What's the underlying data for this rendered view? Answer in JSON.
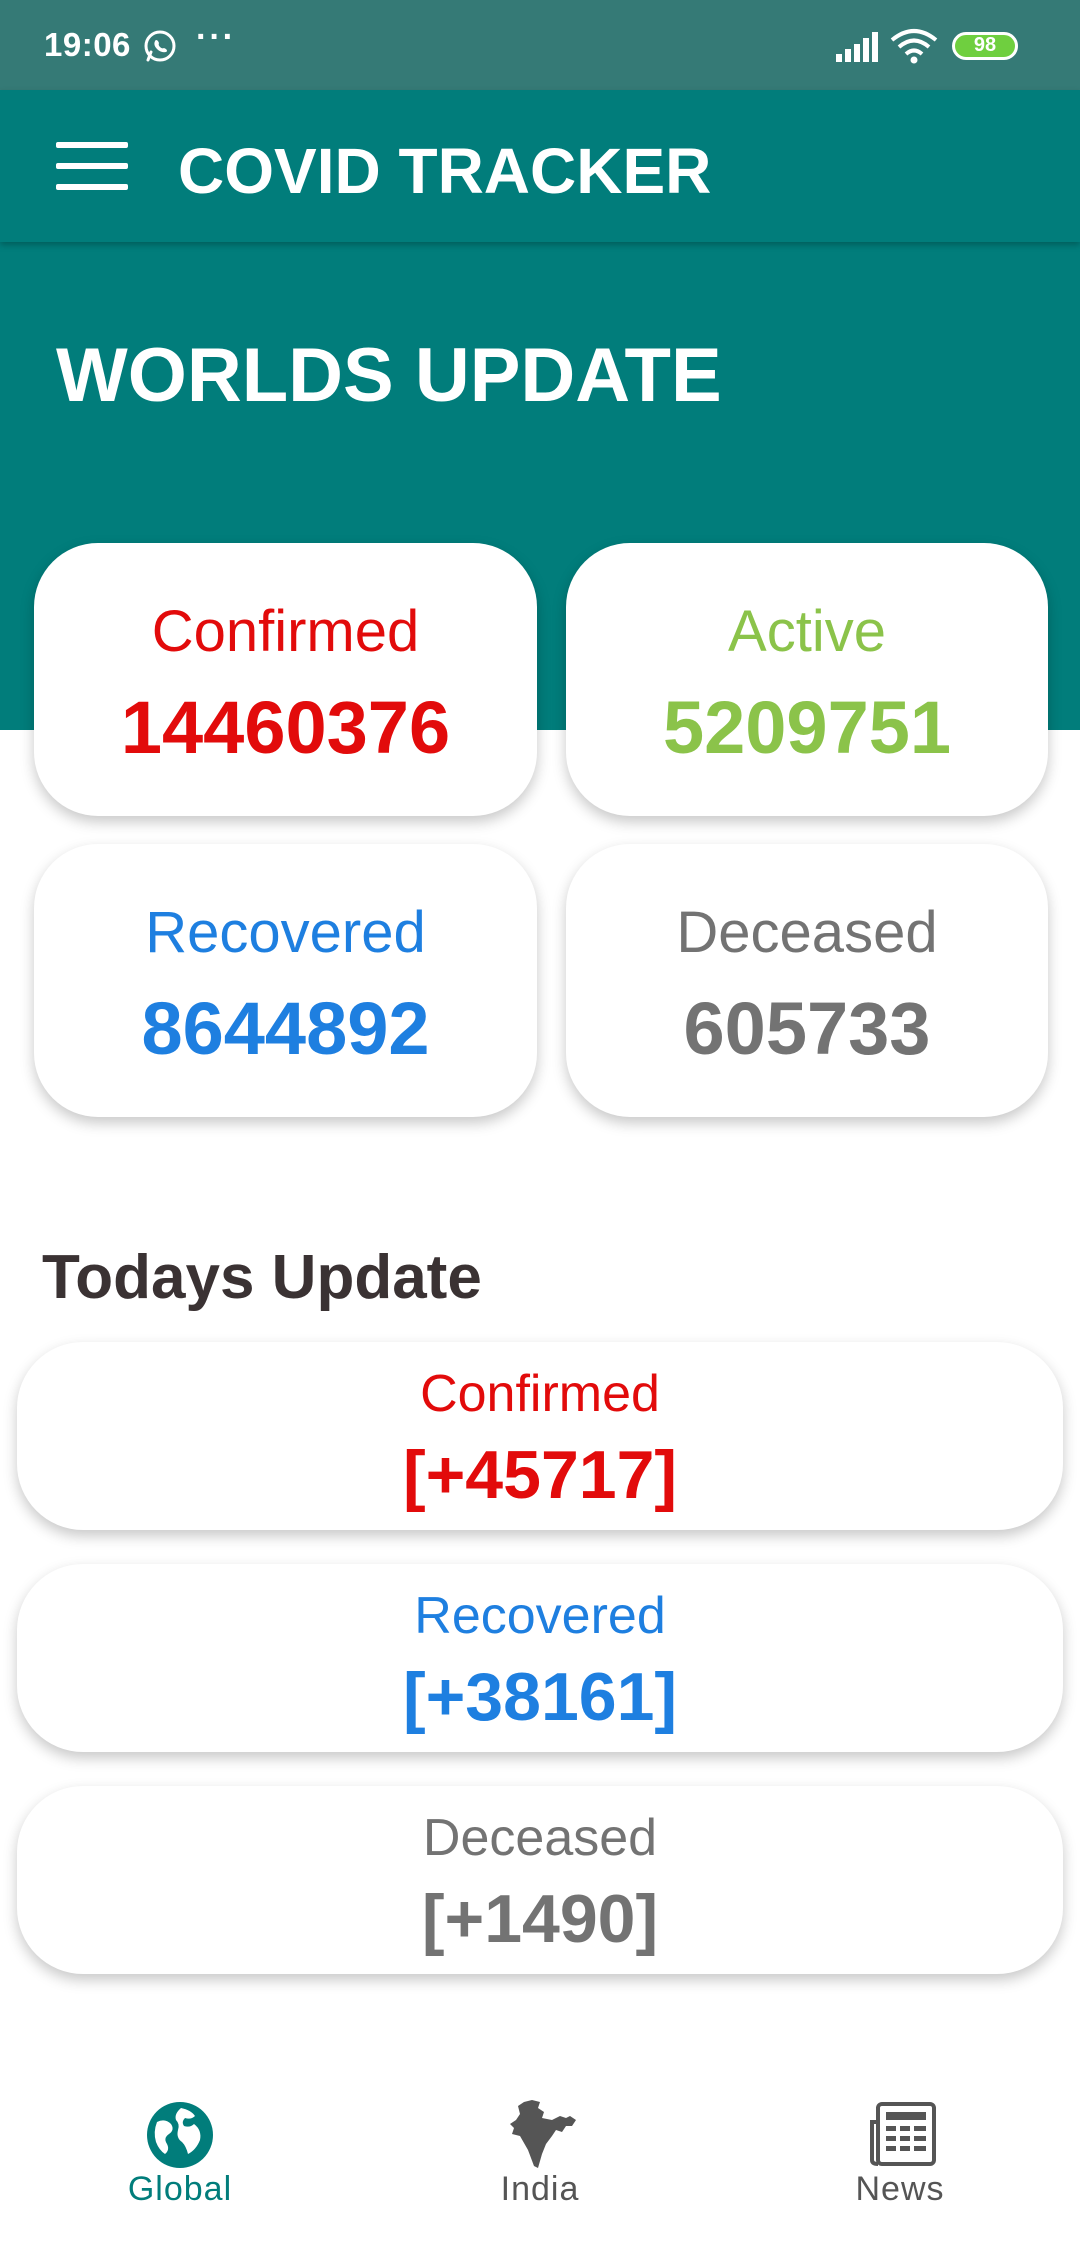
{
  "status": {
    "time": "19:06",
    "battery": "98"
  },
  "app": {
    "title": "COVID TRACKER"
  },
  "world": {
    "title": "WORLDS UPDATE",
    "confirmed_label": "Confirmed",
    "confirmed_value": "14460376",
    "active_label": "Active",
    "active_value": "5209751",
    "recovered_label": "Recovered",
    "recovered_value": "8644892",
    "deceased_label": "Deceased",
    "deceased_value": "605733"
  },
  "today": {
    "title": "Todays Update",
    "confirmed_label": "Confirmed",
    "confirmed_value": "[+45717]",
    "recovered_label": "Recovered",
    "recovered_value": "[+38161]",
    "deceased_label": "Deceased",
    "deceased_value": "[+1490]"
  },
  "nav": {
    "global": "Global",
    "india": "India",
    "news": "News"
  },
  "colors": {
    "teal": "#017d7b",
    "confirmed": "#e20b0b",
    "active": "#8bc34a",
    "recovered": "#1e7fe0",
    "deceased": "#737373"
  },
  "icons": {
    "menu": "menu-icon",
    "global": "globe-icon",
    "india": "india-map-icon",
    "news": "newspaper-icon"
  }
}
